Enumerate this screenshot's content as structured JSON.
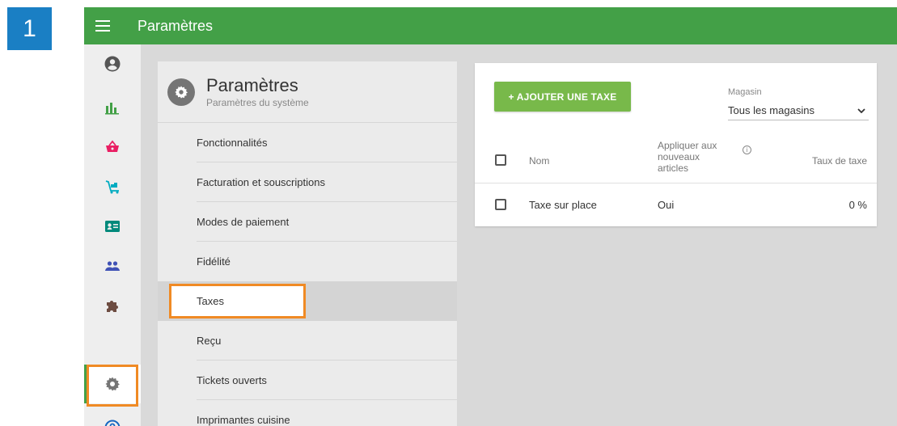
{
  "step_badge": "1",
  "topbar": {
    "title": "Paramètres"
  },
  "rail": {
    "items": [
      {
        "icon": "account-circle-icon",
        "color": "#555555",
        "selected": false
      },
      {
        "icon": "bar-chart-icon",
        "color": "#43a047",
        "selected": false
      },
      {
        "icon": "shopping-basket-icon",
        "color": "#e91e63",
        "selected": false
      },
      {
        "icon": "inventory-cart-icon",
        "color": "#00acc1",
        "selected": false
      },
      {
        "icon": "employee-badge-icon",
        "color": "#00897b",
        "selected": false
      },
      {
        "icon": "customers-icon",
        "color": "#3f51b5",
        "selected": false
      },
      {
        "icon": "puzzle-icon",
        "color": "#6d4c41",
        "selected": false
      },
      {
        "icon": "gear-icon",
        "color": "#757575",
        "selected": true
      },
      {
        "icon": "help-icon",
        "color": "#1565c0",
        "selected": false
      }
    ]
  },
  "settings_panel": {
    "title": "Paramètres",
    "subtitle": "Paramètres du système",
    "items": [
      {
        "label": "Fonctionnalités"
      },
      {
        "label": "Facturation et souscriptions"
      },
      {
        "label": "Modes de paiement"
      },
      {
        "label": "Fidélité"
      },
      {
        "label": "Taxes",
        "active": true
      },
      {
        "label": "Reçu"
      },
      {
        "label": "Tickets ouverts"
      },
      {
        "label": "Imprimantes cuisine"
      }
    ]
  },
  "tax_card": {
    "add_button": "+ AJOUTER UNE TAXE",
    "store_label": "Magasin",
    "store_value": "Tous les magasins",
    "columns": {
      "name": "Nom",
      "apply": "Appliquer aux nouveaux articles",
      "rate": "Taux de taxe"
    },
    "rows": [
      {
        "name": "Taxe sur place",
        "apply": "Oui",
        "rate": "0 %"
      }
    ]
  },
  "colors": {
    "topbar": "#43a047",
    "add_button": "#78b94a",
    "highlight": "#f08a24",
    "badge": "#1a7fc4"
  }
}
